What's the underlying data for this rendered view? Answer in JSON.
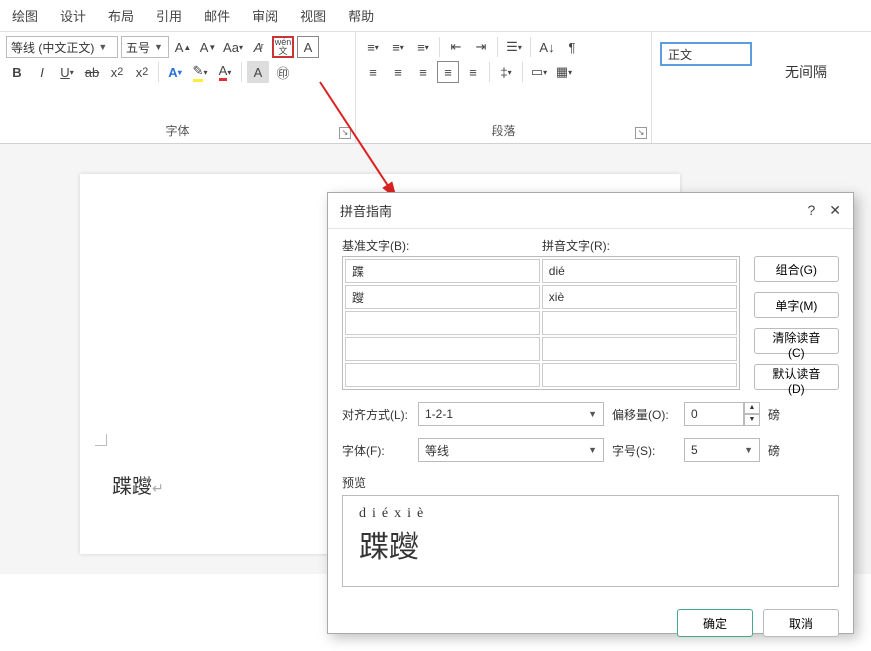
{
  "menubar": [
    "绘图",
    "设计",
    "布局",
    "引用",
    "邮件",
    "审阅",
    "视图",
    "帮助"
  ],
  "ribbon": {
    "font": {
      "name": "等线 (中文正文)",
      "size": "五号",
      "group_label": "字体"
    },
    "paragraph": {
      "group_label": "段落"
    },
    "styles": {
      "body_text": "正文",
      "no_spacing": "无间隔"
    }
  },
  "document": {
    "text": "蹀躞"
  },
  "dialog": {
    "title": "拼音指南",
    "help": "?",
    "base_label": "基准文字(B):",
    "ruby_label": "拼音文字(R):",
    "rows": [
      {
        "base": "蹀",
        "ruby": "dié"
      },
      {
        "base": "躞",
        "ruby": "xiè"
      },
      {
        "base": "",
        "ruby": ""
      },
      {
        "base": "",
        "ruby": ""
      },
      {
        "base": "",
        "ruby": ""
      }
    ],
    "buttons": {
      "combine": "组合(G)",
      "single": "单字(M)",
      "clear": "清除读音(C)",
      "default": "默认读音(D)"
    },
    "align_label": "对齐方式(L):",
    "align_value": "1-2-1",
    "offset_label": "偏移量(O):",
    "offset_value": "0",
    "offset_unit": "磅",
    "font_label": "字体(F):",
    "font_value": "等线",
    "size_label": "字号(S):",
    "size_value": "5",
    "size_unit": "磅",
    "preview_label": "预览",
    "preview_ruby": "diéxiè",
    "preview_base": "蹀躞",
    "ok": "确定",
    "cancel": "取消"
  }
}
